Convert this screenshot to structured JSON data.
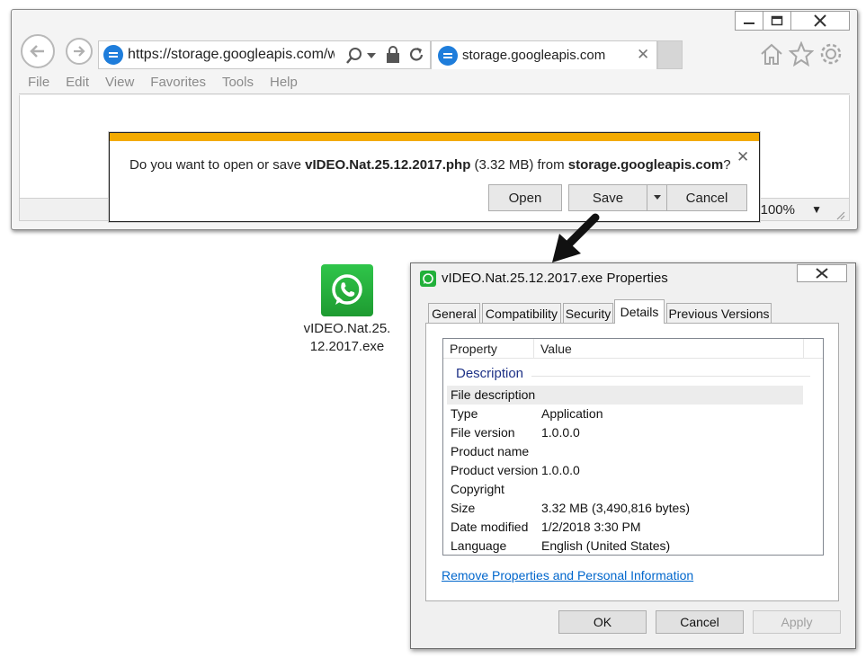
{
  "browser": {
    "address_url": "https://storage.googleapis.com/we",
    "tab_title": "storage.googleapis.com",
    "menu": [
      "File",
      "Edit",
      "View",
      "Favorites",
      "Tools",
      "Help"
    ],
    "zoom": "100%"
  },
  "download": {
    "prompt_start": "Do you want to open or save ",
    "file_name": "vIDEO.Nat.25.12.2017.php",
    "file_size": " (3.32 MB) from ",
    "source": "storage.googleapis.com",
    "prompt_end": "?",
    "open_label": "Open",
    "save_label": "Save",
    "cancel_label": "Cancel"
  },
  "desktop_icon": {
    "label_line1": "vIDEO.Nat.25.",
    "label_line2": "12.2017.exe"
  },
  "properties": {
    "title": "vIDEO.Nat.25.12.2017.exe Properties",
    "tabs": [
      "General",
      "Compatibility",
      "Security",
      "Details",
      "Previous Versions"
    ],
    "active_tab": "Details",
    "columns": [
      "Property",
      "Value"
    ],
    "group": "Description",
    "rows": [
      {
        "key": "File description",
        "value": ""
      },
      {
        "key": "Type",
        "value": "Application"
      },
      {
        "key": "File version",
        "value": "1.0.0.0"
      },
      {
        "key": "Product name",
        "value": ""
      },
      {
        "key": "Product version",
        "value": "1.0.0.0"
      },
      {
        "key": "Copyright",
        "value": ""
      },
      {
        "key": "Size",
        "value": "3.32 MB (3,490,816 bytes)"
      },
      {
        "key": "Date modified",
        "value": "1/2/2018 3:30 PM"
      },
      {
        "key": "Language",
        "value": "English (United States)"
      }
    ],
    "remove_link": "Remove Properties and Personal Information",
    "ok_label": "OK",
    "cancel_label": "Cancel",
    "apply_label": "Apply"
  },
  "colors": {
    "accent_orange": "#f3aa00",
    "link_blue": "#0066cc",
    "whatsapp_green": "#25d366"
  }
}
